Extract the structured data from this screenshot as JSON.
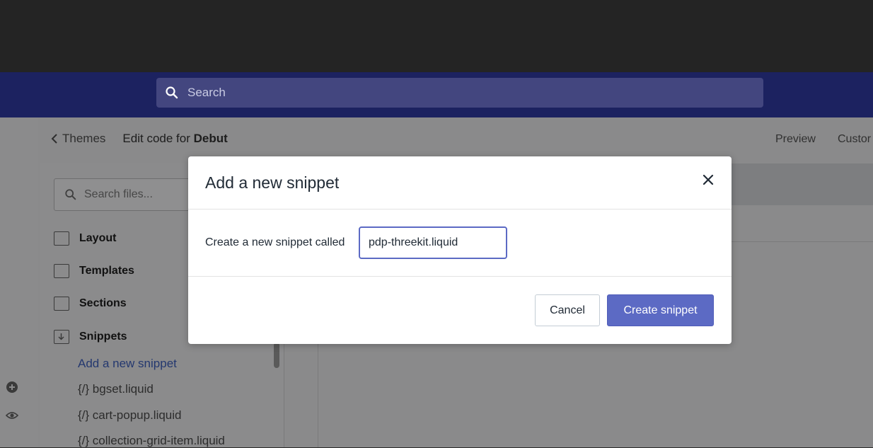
{
  "header": {
    "search_placeholder": "Search",
    "icon": "search-icon"
  },
  "page": {
    "back_label": "Themes",
    "title_prefix": "Edit code for ",
    "title_theme": "Debut",
    "preview_label": "Preview",
    "customize_label": "Custor"
  },
  "sidebar": {
    "search_placeholder": "Search files...",
    "folders": [
      {
        "label": "Layout",
        "icon": "folder-icon"
      },
      {
        "label": "Templates",
        "icon": "folder-icon"
      },
      {
        "label": "Sections",
        "icon": "folder-icon"
      },
      {
        "label": "Snippets",
        "icon": "folder-download-icon"
      }
    ],
    "add_snippet_link": "Add a new snippet",
    "files": [
      "{/} bgset.liquid",
      "{/} cart-popup.liquid",
      "{/} collection-grid-item.liquid"
    ]
  },
  "rail": {
    "icons": [
      "plus-circle-icon",
      "eye-icon"
    ]
  },
  "modal": {
    "title": "Add a new snippet",
    "field_label": "Create a new snippet called",
    "field_value": "pdp-threekit.liquid",
    "cancel_label": "Cancel",
    "create_label": "Create snippet",
    "accent": "#5c6ac4"
  }
}
